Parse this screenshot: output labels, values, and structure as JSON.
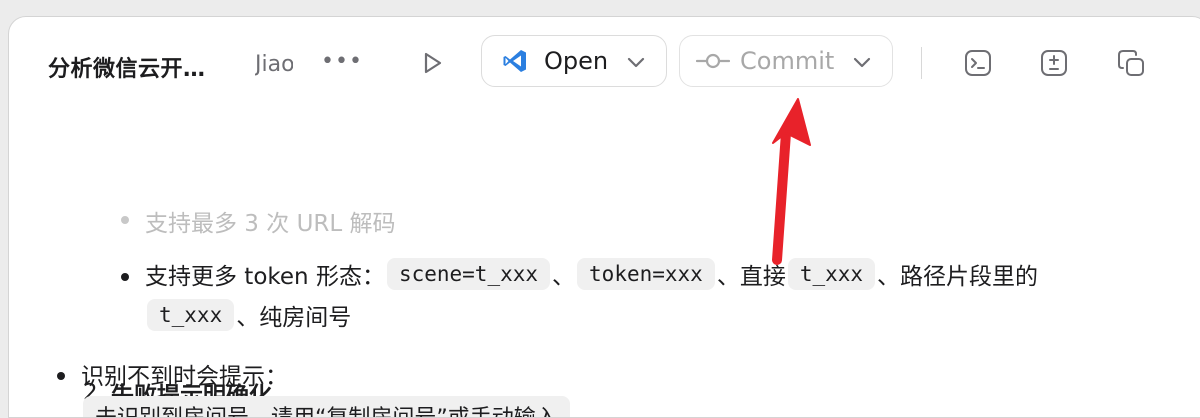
{
  "toolbar": {
    "title": "分析微信云开…",
    "subtitle": "Jiao",
    "more": "•••",
    "open_label": "Open",
    "commit_label": "Commit"
  },
  "icons": {
    "play": "play-icon",
    "vscode": "vscode-icon",
    "open_chevron": "chevron-down-icon",
    "commit": "git-commit-icon",
    "commit_chevron": "chevron-down-icon",
    "terminal": "terminal-icon",
    "diff": "diff-icon",
    "copy": "copy-icon"
  },
  "colors": {
    "vscode_blue": "#2b7fe0",
    "arrow_red": "#e8222a",
    "code_bg": "#f0f0f0"
  },
  "content": {
    "bullet1": "支持最多 3 次 URL 解码",
    "bullet2": {
      "prefix": "支持更多 token 形态：",
      "code1": "scene=t_xxx",
      "sep1": "、",
      "code2": "token=xxx",
      "sep2": "、直接",
      "code3": "t_xxx",
      "suffix": "、路径片段里的",
      "code4": "t_xxx",
      "tail": "、纯房间号"
    },
    "heading_number": "2.",
    "heading_text": "失败提示明确化",
    "bullet3": "识别不到时会提示：",
    "quote": "未识别到房间号，请用“复制房间号”或手动输入"
  }
}
